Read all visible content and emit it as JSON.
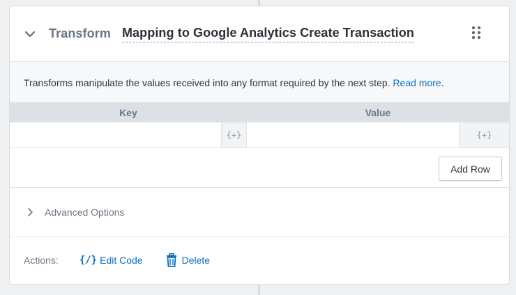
{
  "step": {
    "type": "Transform",
    "name": "Mapping to Google Analytics Create Transaction"
  },
  "info": {
    "text": "Transforms manipulate the values received into any format required by the next step. ",
    "link": "Read more",
    "suffix": "."
  },
  "table": {
    "headers": [
      "Key",
      "Value"
    ],
    "rows": [
      {
        "key": "",
        "value": "",
        "key_var": "{+}",
        "value_var": "{+}"
      }
    ],
    "add_row_label": "Add Row"
  },
  "advanced": {
    "label": "Advanced Options"
  },
  "actions": {
    "label": "Actions:",
    "edit_code_icon": "{/}",
    "edit_code": "Edit Code",
    "delete": "Delete"
  },
  "colors": {
    "accent": "#0a6ebd",
    "muted": "#6b7682",
    "header_bg": "#dde1e6"
  },
  "icons": {
    "collapse": "chevron-down-icon",
    "drag": "drag-handle-icon",
    "expand": "chevron-right-icon",
    "code": "code-icon",
    "delete": "trash-icon"
  }
}
